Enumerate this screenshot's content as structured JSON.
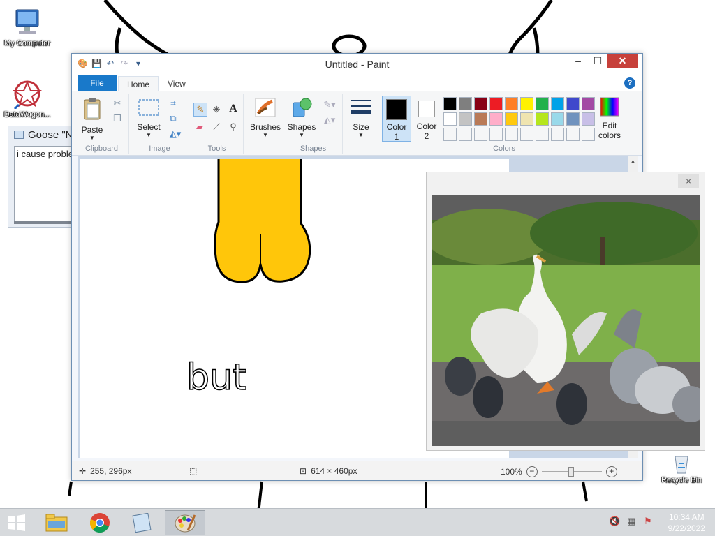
{
  "desktop": {
    "icons": [
      {
        "label": "My Computer"
      },
      {
        "label": "DataWagon..."
      },
      {
        "label": "Recycle Bin"
      }
    ]
  },
  "note_window": {
    "title": "Goose \"N",
    "text": "i cause proble"
  },
  "paint": {
    "title": "Untitled - Paint",
    "tabs": {
      "file": "File",
      "home": "Home",
      "view": "View"
    },
    "help": "?",
    "ribbon": {
      "clipboard": {
        "label": "Clipboard",
        "paste": "Paste"
      },
      "image": {
        "label": "Image",
        "select": "Select"
      },
      "tools": {
        "label": "Tools"
      },
      "shapes": {
        "label": "Shapes",
        "brushes": "Brushes",
        "shapes_btn": "Shapes"
      },
      "size": "Size",
      "colors": {
        "label": "Colors",
        "color1": "Color\n1",
        "color1_line1": "Color",
        "color1_line2": "1",
        "color2_line1": "Color",
        "color2_line2": "2",
        "edit_line1": "Edit",
        "edit_line2": "colors",
        "color1_value": "#000000",
        "color2_value": "#ffffff",
        "palette_row1": [
          "#000000",
          "#7f7f7f",
          "#880015",
          "#ed1c24",
          "#ff7f27",
          "#fff200",
          "#22b14c",
          "#00a2e8",
          "#3f48cc",
          "#a349a4"
        ],
        "palette_row2": [
          "#ffffff",
          "#c3c3c3",
          "#b97a57",
          "#ffaec9",
          "#ffc90e",
          "#efe4b0",
          "#b5e61d",
          "#99d9ea",
          "#7092be",
          "#c8bfe7"
        ]
      }
    },
    "canvas": {
      "handwriting": "but",
      "fill_color": "#ffc60a"
    },
    "status": {
      "cursor_pos": "255, 296px",
      "image_size": "614 × 460px",
      "zoom": "100%"
    }
  },
  "popup": {
    "close": "×"
  },
  "taskbar": {
    "time": "10:34 AM",
    "date": "9/22/2022"
  }
}
